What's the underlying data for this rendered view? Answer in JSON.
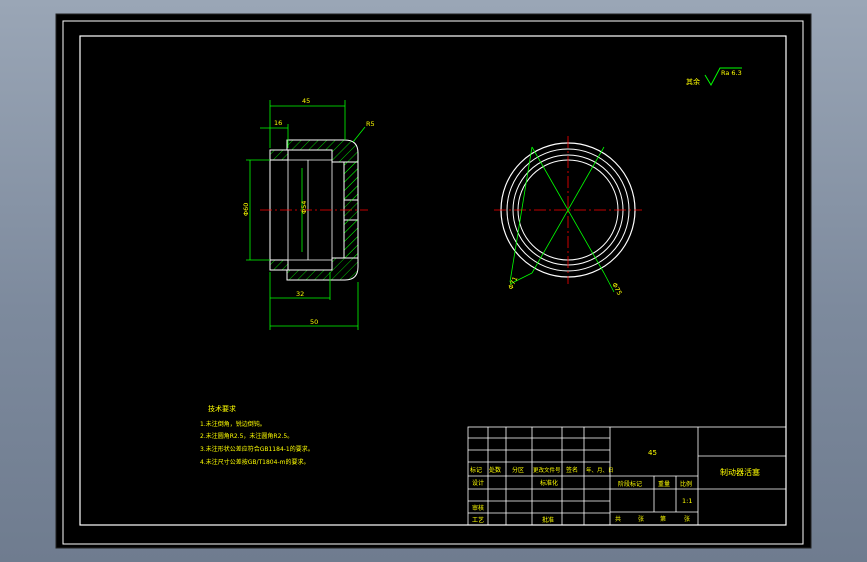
{
  "colors": {
    "background": "#000000",
    "outer_chrome": "#8794a6",
    "outline": "#ffffff",
    "dimension": "#00ff00",
    "hatch": "#00ff00",
    "centerline": "#ff0000",
    "label": "#ffff00"
  },
  "surface_finish": {
    "prefix": "其余",
    "value": "Ra 6.3"
  },
  "front_view": {
    "dim_top_width": "45",
    "dim_inner_step": "16",
    "chamfer_label": "R5",
    "dim_left_diameter": "Φ60",
    "dim_inner_diameter": "Φ54",
    "dim_bottom_depth": "32",
    "dim_overall_length": "50"
  },
  "side_view": {
    "left_diameter_label": "Φ71",
    "right_diameter_label": "Φ75"
  },
  "tech_notes": {
    "title": "技术要求",
    "items": [
      "1.未注倒角，锐边倒钝。",
      "2.未注圆角R2.5，未注圆角R2.5。",
      "3.未注形状公差应符合GB1184-1的要求。",
      "4.未注尺寸公差按GB/T1804-m的要求。"
    ]
  },
  "title_block": {
    "material": "45",
    "part_name": "制动器活塞",
    "scale": "1:1",
    "header_labels": [
      "标记",
      "处数",
      "分区",
      "更改文件号",
      "签名",
      "年、月、日"
    ],
    "row_design": "设计",
    "row_standard": "标准化",
    "row_stage_mark": "阶段标记",
    "row_weight": "重量",
    "row_scale": "比例",
    "row_review": "审核",
    "row_process": "工艺",
    "row_approve": "批准",
    "row_sheets": [
      "共",
      "张",
      "第",
      "张"
    ]
  }
}
